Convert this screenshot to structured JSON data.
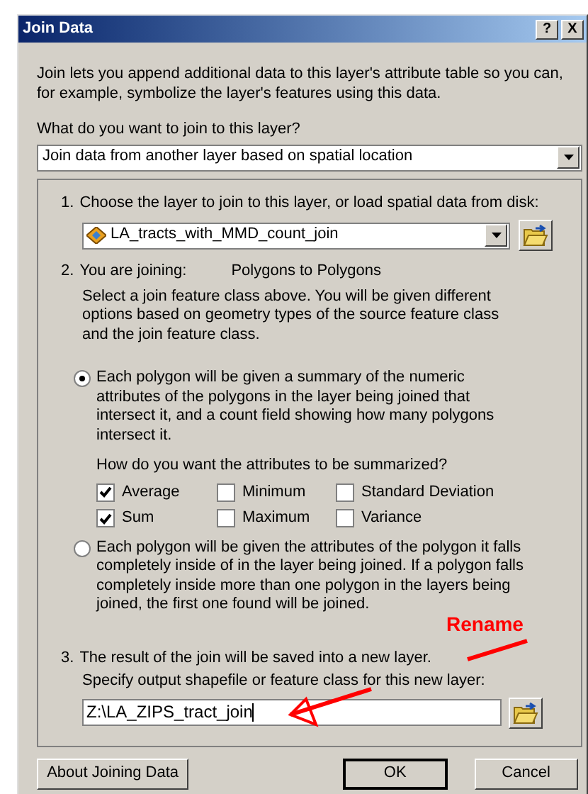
{
  "window": {
    "title": "Join Data",
    "controls": [
      "?",
      "X"
    ]
  },
  "intro": "Join lets you append additional data to this layer's attribute table so you can, for example, symbolize the layer's features using this data.",
  "join_type": {
    "label": "What do you want to join to this layer?",
    "value": "Join data from another layer based on spatial location"
  },
  "step1": {
    "number": "1.",
    "label": "Choose the layer to join to this layer, or load spatial data from disk:",
    "layer": "LA_tracts_with_MMD_count_join"
  },
  "step2": {
    "number": "2.",
    "label": "You are joining:",
    "value": "Polygons to Polygons",
    "description": "Select a join feature class above.  You will be given different options based on geometry types of the source feature class and the join feature class."
  },
  "options": [
    {
      "selected": true,
      "text": "Each polygon will be given a summary of the numeric attributes of the polygons in the layer being joined that intersect it, and a count field showing how many polygons intersect it.",
      "question": "How do you want the attributes to be summarized?",
      "checkboxes": [
        {
          "label": "Average",
          "checked": true
        },
        {
          "label": "Minimum",
          "checked": false
        },
        {
          "label": "Standard Deviation",
          "checked": false
        },
        {
          "label": "Sum",
          "checked": true
        },
        {
          "label": "Maximum",
          "checked": false
        },
        {
          "label": "Variance",
          "checked": false
        }
      ]
    },
    {
      "selected": false,
      "text": "Each polygon will be given the attributes of the polygon it falls completely inside of in the layer being joined. If a polygon falls completely inside more than one polygon in the layers being joined, the first one found will be joined."
    }
  ],
  "step3": {
    "number": "3.",
    "label": "The result of the join will be saved into a new layer.",
    "prompt": "Specify output shapefile or feature class for this new layer:",
    "output_path": "Z:\\LA_ZIPS_tract_join"
  },
  "buttons": [
    "About Joining Data",
    "OK",
    "Cancel"
  ],
  "annotation": {
    "text": "Rename"
  }
}
